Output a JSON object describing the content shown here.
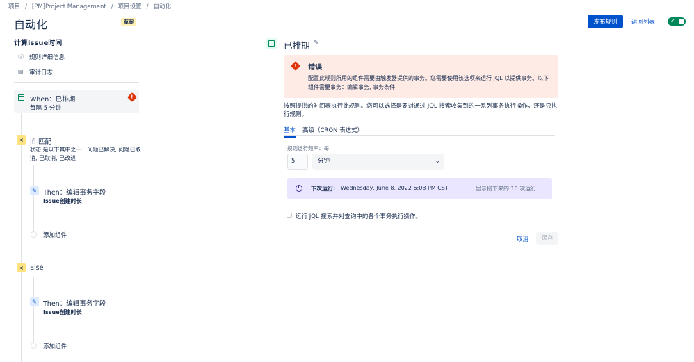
{
  "breadcrumb": [
    "项目",
    "[PM]Project Management",
    "项目设置",
    "自动化"
  ],
  "page": {
    "title": "自动化",
    "badge": "草案"
  },
  "header": {
    "publish": "发布规则",
    "back": "返回列表",
    "toggle_on": true
  },
  "sidebar": {
    "rule_name": "计算issue时间",
    "links": [
      {
        "label": "规则详细信息",
        "icon": "info-icon"
      },
      {
        "label": "审计日志",
        "icon": "document-icon"
      }
    ]
  },
  "flow": {
    "when": {
      "title": "When：已排期",
      "sub": "每隔 5 分钟",
      "error_icon": "!"
    },
    "if": {
      "title": "If: 匹配",
      "desc": "状态 是以下其中之一：问题已解决, 问题已取消, 已取消, 已改进"
    },
    "then1": {
      "title": "Then：编辑事务字段",
      "sub": "Issue创建时长"
    },
    "add1": "添加组件",
    "else": {
      "title": "Else"
    },
    "then2": {
      "title": "Then：编辑事务字段",
      "sub": "Issue创建时长"
    },
    "add2": "添加组件"
  },
  "panel": {
    "title": "已排期",
    "error": {
      "title": "错误",
      "text": "配置此规则所用的组件需要由触发器提供的事务。您需要使用该选项来运行 JQL 以提供事务。以下组件需要事务：编辑事务, 事务条件",
      "icon": "!"
    },
    "description": "按照提供的时间表执行此规则。您可以选择是要对通过 JQL 搜索收集到的一系列事务执行操作，还是只执行规则。",
    "tabs": [
      {
        "label": "基本"
      },
      {
        "label": "高级（CRON 表达式）"
      }
    ],
    "freq_label": "规则运行频率：每",
    "freq_value": "5",
    "unit": "分钟",
    "next_run_label": "下次运行:",
    "next_run_value": "Wednesday, June 8, 2022 6:08 PM CST",
    "show_next": "显示接下来的 10 次运行",
    "jql_label": "运行 JQL 搜索并对查询中的各个事务执行操作。",
    "cancel": "取消",
    "save": "保存"
  }
}
